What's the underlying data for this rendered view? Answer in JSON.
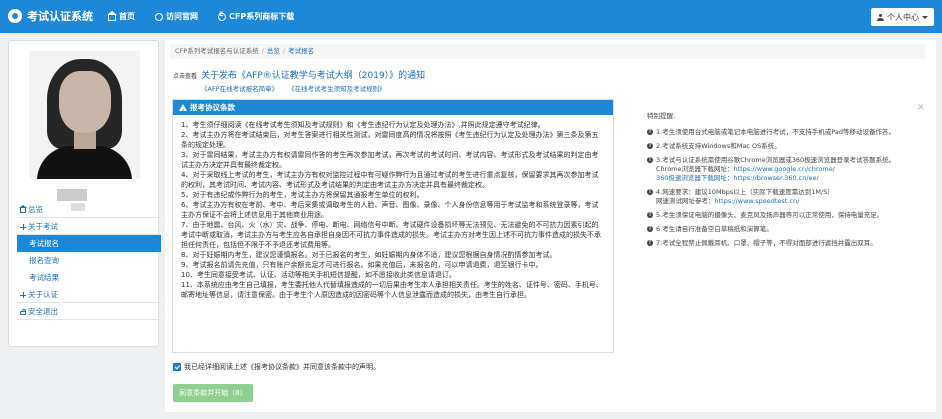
{
  "header": {
    "brand": "考试认证系统",
    "nav": [
      {
        "label": "首页"
      },
      {
        "label": "访问官网"
      },
      {
        "label": "CFP系列商标下载"
      }
    ],
    "user_menu": "个人中心"
  },
  "sidebar": {
    "items": [
      {
        "label": "总览",
        "level": "top"
      },
      {
        "label": "关于考试",
        "level": "top"
      },
      {
        "label": "考试报名",
        "level": "sub",
        "active": true
      },
      {
        "label": "报名查询",
        "level": "sub"
      },
      {
        "label": "考试结果",
        "level": "sub"
      },
      {
        "label": "关于认证",
        "level": "top"
      },
      {
        "label": "安全退出",
        "level": "top"
      }
    ]
  },
  "breadcrumb": {
    "root": "CFP系列考试报名与认证系统",
    "overview": "总览",
    "current": "考试报名"
  },
  "notice": {
    "prefix": "点击查看",
    "link": "关于发布《AFP®认证教学与考试大纲（2019）》的通知"
  },
  "sublinks": [
    "《AFP在线考试报名简章》",
    "《在线考试考生须知及考试规则》"
  ],
  "agreement": {
    "title": "报考协议条款",
    "body": "1、考生须仔细阅读《在线考试考生须知及考试规则》和《考生违纪行为认定及处理办法》,并照此规定遵守考试纪律。\n2、考试主办方将在考试结束后，对考生答案进行相关性测试，对雷同度高的情况将按照《考生违纪行为认定及处理办法》第三条及第五条的规定处理。\n3、对于雷同结果，考试主办方有权请雷同作答的考生再次参加考试，再次考试的考试时间、考试内容、考试形式及考试结果的判定由考试主办方决定并具有最终裁定权。\n4、对于采取线上考试的考生，考试主办方有权对监控过程中有可疑作弊行为且通过考试的考生进行重点复核，保留要求其再次参加考试的权利，其考试时间、考试内容、考试形式及考试结果的判定由考试主办方决定并具有最终裁定权。\n5、对于有违纪或作弊行为的考生，考试主办方将保留其通报考生单位的权利。\n6、考试主办方有权在考前、考中、考后采集或调取考生的人脸、声音、图像、录像、个人身份信息等用于考试监考和系统登录等，考试主办方保证不会将上述信息用于其他商业用途。\n7、由于地震、台风、火（水）灾、战争、停电、断电、网络信号中断、考试硬件设备损坏等无法预见、无法避免的不可抗力因素引起的考试中断或取消，考试主办方与考生应各自承担自身因不可抗力事件造成的损失。考试主办方对考生因上述不可抗力事件造成的损失不承担任何责任，包括但不限于不予退还考试费用等。\n8、对于妊娠期内考生，建议您谨慎报名。对于已报名的考生，如妊娠期内身体不适，建议您根据自身情况酌情参加考试。\n9、考试报名前请先充值，只有账户余额充足才可进行报名。如果充值后，未报名的，可以申请退费，退至银行卡中。\n10、考生同意接受考试、认证、活动等相关手机短信提醒，如不愿接收此类信息请退订。\n11、本系统应由考生自己填报，考生委托他人代替填报造成的一切后果由考生本人承担相关责任。考生的姓名、证件号、密码、手机号、邮寄地址等信息，请注意保密。由于考生个人原因造成的因密码等个人信息泄露而造成的损失，由考生自行承担。"
  },
  "agree_checkbox_label": "我已经详细阅读上述《报考协议条款》并同意该条款中的声明。",
  "agree_button": "同意条款并开始（8）",
  "tips": {
    "title": "特别提醒:",
    "items": [
      {
        "text": "1.考生须使用台式电脑或笔记本电脑进行考试，不支持手机或Pad等移动设备作答。"
      },
      {
        "text": "2.考试系统支持Windows和Mac OS系统。"
      },
      {
        "text": "3.考试与认证系统需使用谷歌Chrome浏览器或360极速浏览器登录考试答题系统。",
        "line2": "Chrome浏览器下载网址：",
        "link2": "https://www.google.cn/chrome/",
        "line3": "360极速浏览器下载网址：",
        "link3": "https://browser.360.cn/ee/"
      },
      {
        "text": "4.网速要求：建议10Mbps以上（实际下载速度需达到1M/S）",
        "line2": "网速测试网址参考：",
        "link2": "https://www.speedtest.cn/"
      },
      {
        "text": "5.考生须保证电脑的摄像头、麦克风及扬声器等可以正常使用，保持电量充足。"
      },
      {
        "text": "6.考生请自行准备空白草稿纸和演算笔。"
      },
      {
        "text": "7.考试全程禁止佩戴耳机、口罩、帽子等，不得对面部进行遮挡并露出双耳。"
      }
    ]
  }
}
